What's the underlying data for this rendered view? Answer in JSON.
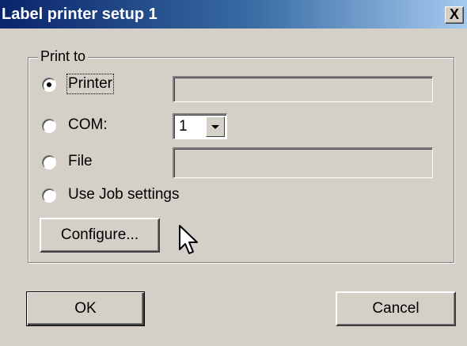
{
  "window": {
    "title": "Label printer setup 1",
    "close_label": "X"
  },
  "group": {
    "label": "Print to"
  },
  "options": {
    "printer": {
      "label": "Printer",
      "checked": true,
      "value": ""
    },
    "com": {
      "label": "COM:",
      "checked": false,
      "selected": "1"
    },
    "file": {
      "label": "File",
      "checked": false,
      "value": ""
    },
    "job": {
      "label": "Use Job settings",
      "checked": false
    }
  },
  "buttons": {
    "configure": "Configure...",
    "ok": "OK",
    "cancel": "Cancel"
  },
  "icons": {
    "cursor": "mouse-pointer-icon"
  }
}
